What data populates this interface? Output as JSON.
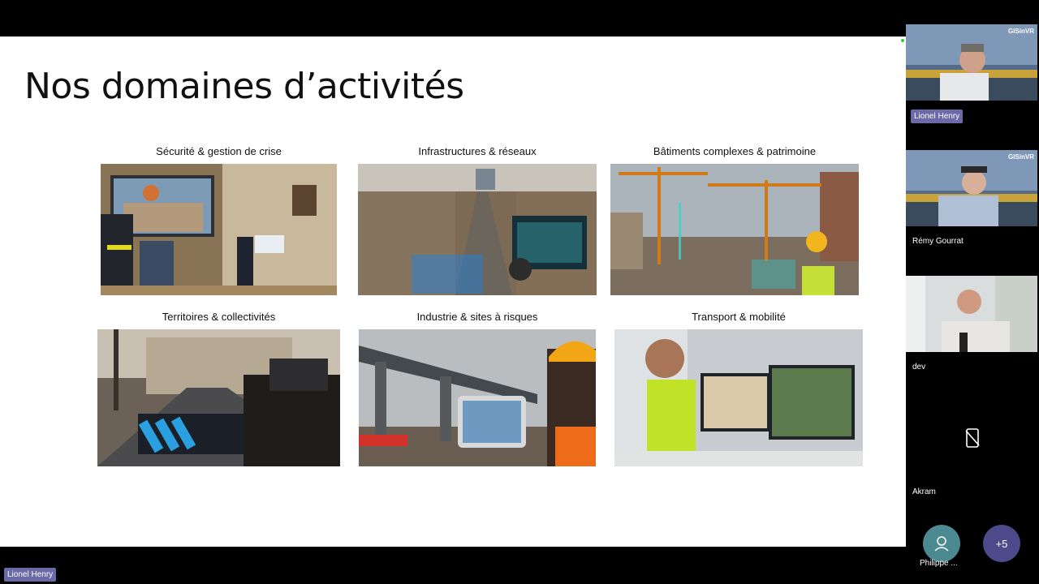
{
  "slide": {
    "title": "Nos domaines d’activités",
    "tiles": [
      {
        "label": "Sécurité & gestion de crise"
      },
      {
        "label": "Infrastructures & réseaux"
      },
      {
        "label": "Bâtiments complexes & patrimoine"
      },
      {
        "label": "Territoires & collectivités"
      },
      {
        "label": "Industrie & sites à risques"
      },
      {
        "label": "Transport & mobilité"
      }
    ]
  },
  "participants": {
    "tiles": [
      {
        "name": "Lionel Henry",
        "overlay": "GISinVR"
      },
      {
        "name": "Rémy Gourrat",
        "overlay": "GISinVR"
      },
      {
        "name": "dev"
      },
      {
        "name": "Akram"
      }
    ],
    "more_participant": {
      "name": "Philippe ...",
      "icon": "user-icon"
    },
    "overflow": {
      "label": "+5"
    }
  },
  "presenter": {
    "name": "Lionel Henry"
  },
  "colors": {
    "name_tag": "#6a6aa8",
    "avatar": "#4a8a90",
    "overflow": "#4c4a8a"
  }
}
